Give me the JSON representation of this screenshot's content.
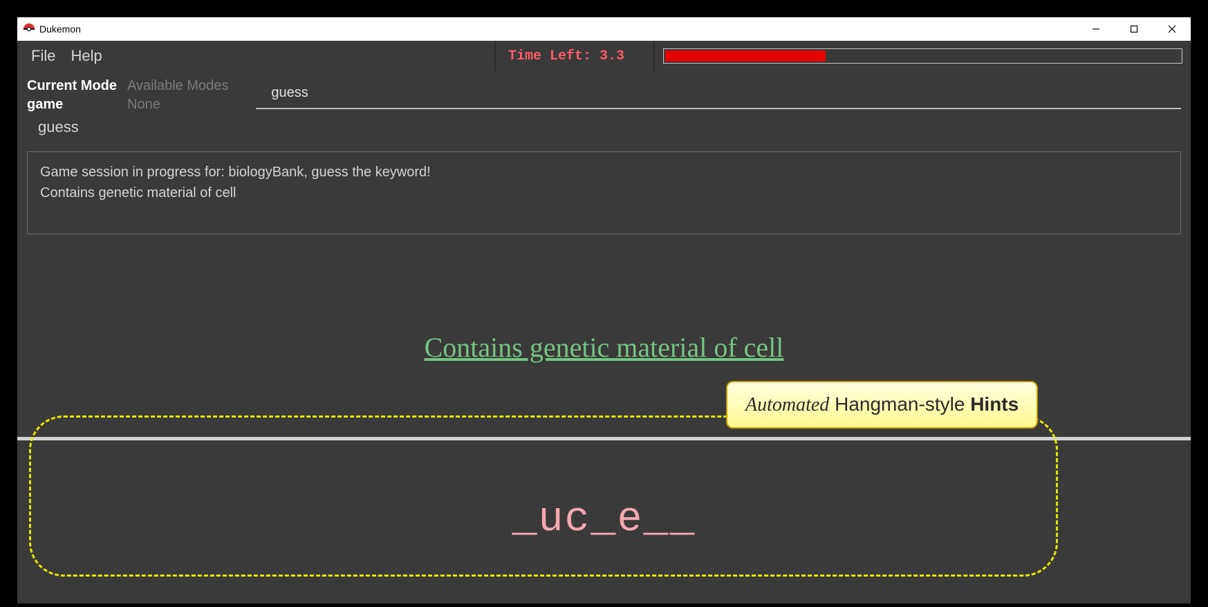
{
  "window": {
    "title": "Dukemon"
  },
  "menu": {
    "file": "File",
    "help": "Help"
  },
  "timer": {
    "label": "Time Left: 3.3",
    "fill_percent": 31
  },
  "mode": {
    "current_label": "Current Mode",
    "current_value": "game",
    "available_label": "Available Modes",
    "available_value": "None"
  },
  "input": {
    "value": "guess"
  },
  "second_line": "guess",
  "status": {
    "line1": "Game session in progress for: biologyBank, guess the keyword!",
    "line2": "Contains genetic material of cell"
  },
  "clue": "Contains genetic material of cell",
  "masked_answer": "_uc_e__",
  "callout": {
    "word_automated": "Automated",
    "word_middle": " Hangman-style ",
    "word_hints": "Hints"
  }
}
